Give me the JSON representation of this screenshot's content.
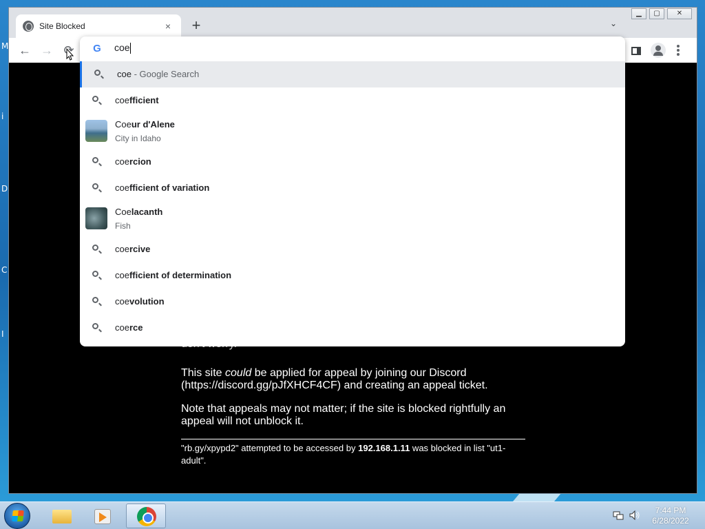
{
  "desktop": {
    "edge_letters": [
      "M",
      "i",
      "D",
      "C",
      "I"
    ]
  },
  "browser": {
    "tab": {
      "title": "Site Blocked",
      "close": "×"
    },
    "new_tab": "+",
    "tab_search": "⌄",
    "window_controls": {
      "minimize": "▁",
      "maximize": "▢",
      "close": "✕"
    },
    "nav": {
      "back": "←",
      "forward": "→",
      "reload": "⟳"
    },
    "omnibox": {
      "value": "coe",
      "suggestions": [
        {
          "typed": "coe",
          "completion": "",
          "suffix": " - Google Search",
          "subtitle": "",
          "type": "search",
          "selected": true
        },
        {
          "typed": "coe",
          "completion": "fficient",
          "suffix": "",
          "subtitle": "",
          "type": "search"
        },
        {
          "typed": "Coe",
          "completion": "ur d'Alene",
          "suffix": "",
          "subtitle": "City in Idaho",
          "type": "entity"
        },
        {
          "typed": "coe",
          "completion": "rcion",
          "suffix": "",
          "subtitle": "",
          "type": "search"
        },
        {
          "typed": "coe",
          "completion": "fficient of variation",
          "suffix": "",
          "subtitle": "",
          "type": "search"
        },
        {
          "typed": "Coe",
          "completion": "lacanth",
          "suffix": "",
          "subtitle": "Fish",
          "type": "entity"
        },
        {
          "typed": "coe",
          "completion": "rcive",
          "suffix": "",
          "subtitle": "",
          "type": "search"
        },
        {
          "typed": "coe",
          "completion": "fficient of determination",
          "suffix": "",
          "subtitle": "",
          "type": "search"
        },
        {
          "typed": "coe",
          "completion": "volution",
          "suffix": "",
          "subtitle": "",
          "type": "search"
        },
        {
          "typed": "coe",
          "completion": "rce",
          "suffix": "",
          "subtitle": "",
          "type": "search"
        }
      ]
    }
  },
  "page": {
    "dont_worry": "don't worry.",
    "appeal_line1_pre": "This site ",
    "appeal_line1_em": "could",
    "appeal_line1_post": " be applied for appeal by joining our Discord (https://discord.gg/pJfXHCF4CF) and creating an appeal ticket.",
    "note": "Note that appeals may not matter; if the site is blocked rightfully an appeal will not unblock it.",
    "footer_pre": "\"rb.gy/xpypd2\" attempted to be accessed by ",
    "footer_ip": "192.168.1.11",
    "footer_post": " was blocked in list \"ut1-adult\"."
  },
  "taskbar": {
    "clock_time": "7:44 PM",
    "clock_date": "6/28/2022"
  },
  "colors": {
    "accent": "#1a73e8",
    "page_bg": "#000000",
    "chrome_frame": "#dee1e6"
  }
}
